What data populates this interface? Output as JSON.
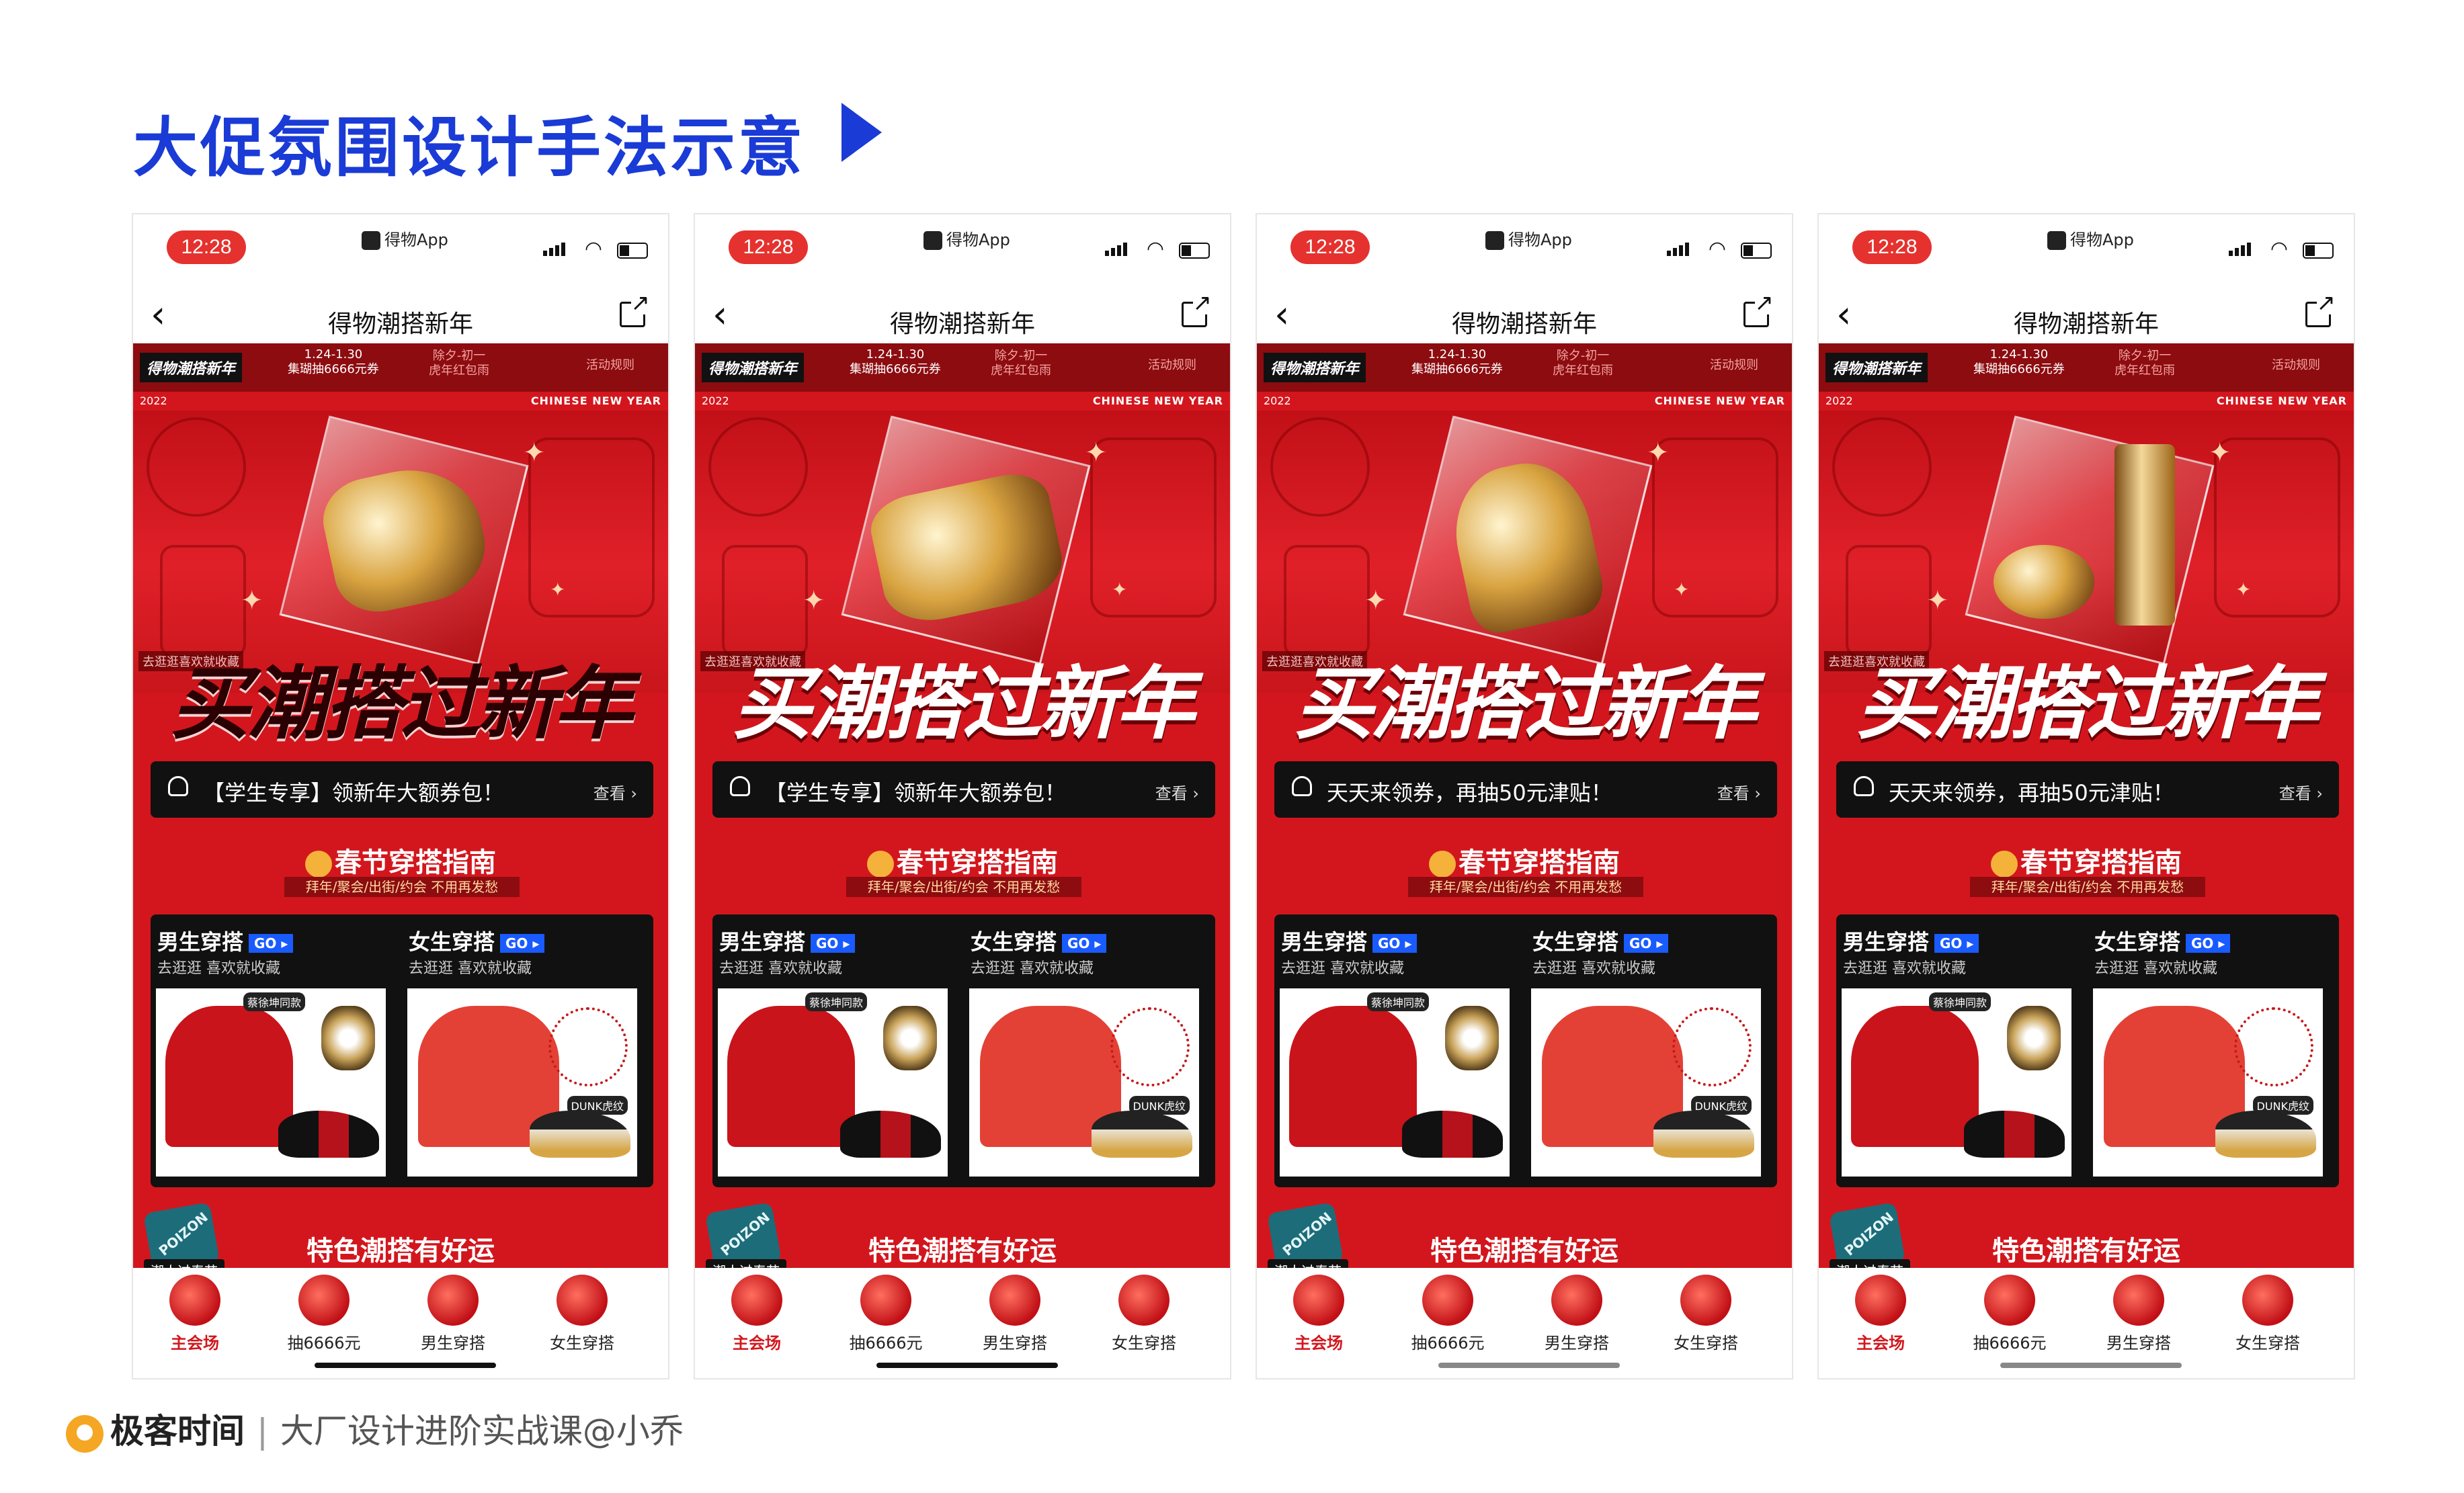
{
  "slide": {
    "title": "大促氛围设计手法示意",
    "arrow_icon": "play-triangle-icon",
    "accent": "#1a3bd6"
  },
  "phones": [
    {
      "status_time": "12:28",
      "app_tag": "得物App",
      "nav_title": "得物潮搭新年",
      "top": {
        "brand": "得物潮搭新年",
        "date": "1.24-1.30",
        "date_sub": "集瑚抽6666元券",
        "deal": "除夕-初一",
        "deal_sub": "虎年红包雨",
        "act": "活动规则"
      },
      "year": "2022",
      "cny": "CHINESE NEW YEAR",
      "hero_hint": "去逛逛喜欢就收藏",
      "hero_product": "sneaker",
      "slogan": "买潮搭过新年",
      "notice": "【学生专享】领新年大额券包！",
      "notice_more": "查看 ›",
      "section_title": "春节穿搭指南",
      "section_sub": "拜年/聚会/出街/约会 不用再发愁",
      "men_title": "男生穿搭",
      "women_title": "女生穿搭",
      "go": "GO ▸",
      "men_sub": "去逛逛 喜欢就收藏",
      "women_sub": "去逛逛 喜欢就收藏",
      "men_tag": "蔡徐坤同款",
      "women_tag": "DUNK虎纹",
      "feature_title": "特色潮搭有好运",
      "badge": "POIZON",
      "badge_label": "潮人过春节",
      "tabs": [
        "主会场",
        "抽6666元",
        "男生穿搭",
        "女生穿搭"
      ]
    },
    {
      "status_time": "12:28",
      "app_tag": "得物App",
      "nav_title": "得物潮搭新年",
      "top": {
        "brand": "得物潮搭新年",
        "date": "1.24-1.30",
        "date_sub": "集瑚抽6666元券",
        "deal": "除夕-初一",
        "deal_sub": "虎年红包雨",
        "act": "活动规则"
      },
      "year": "2022",
      "cny": "CHINESE NEW YEAR",
      "hero_hint": "去逛逛喜欢就收藏",
      "hero_product": "bag",
      "slogan": "买潮搭过新年",
      "notice": "【学生专享】领新年大额券包！",
      "notice_more": "查看 ›",
      "section_title": "春节穿搭指南",
      "section_sub": "拜年/聚会/出街/约会 不用再发愁",
      "men_title": "男生穿搭",
      "women_title": "女生穿搭",
      "go": "GO ▸",
      "men_sub": "去逛逛 喜欢就收藏",
      "women_sub": "去逛逛 喜欢就收藏",
      "men_tag": "蔡徐坤同款",
      "women_tag": "DUNK虎纹",
      "feature_title": "特色潮搭有好运",
      "badge": "POIZON",
      "badge_label": "潮人过春节",
      "tabs": [
        "主会场",
        "抽6666元",
        "男生穿搭",
        "女生穿搭"
      ]
    },
    {
      "status_time": "12:28",
      "app_tag": "得物App",
      "nav_title": "得物潮搭新年",
      "top": {
        "brand": "得物潮搭新年",
        "date": "1.24-1.30",
        "date_sub": "集瑚抽6666元券",
        "deal": "除夕-初一",
        "deal_sub": "虎年红包雨",
        "act": "活动规则"
      },
      "year": "2022",
      "cny": "CHINESE NEW YEAR",
      "hero_hint": "去逛逛喜欢就收藏",
      "hero_product": "dress",
      "slogan": "买潮搭过新年",
      "notice": "天天来领券，再抽50元津贴！",
      "notice_more": "查看 ›",
      "section_title": "春节穿搭指南",
      "section_sub": "拜年/聚会/出街/约会 不用再发愁",
      "men_title": "男生穿搭",
      "women_title": "女生穿搭",
      "go": "GO ▸",
      "men_sub": "去逛逛 喜欢就收藏",
      "women_sub": "去逛逛 喜欢就收藏",
      "men_tag": "蔡徐坤同款",
      "women_tag": "DUNK虎纹",
      "feature_title": "特色潮搭有好运",
      "badge": "POIZON",
      "badge_label": "潮人过春节",
      "tabs": [
        "主会场",
        "抽6666元",
        "男生穿搭",
        "女生穿搭"
      ]
    },
    {
      "status_time": "12:28",
      "app_tag": "得物App",
      "nav_title": "得物潮搭新年",
      "top": {
        "brand": "得物潮搭新年",
        "date": "1.24-1.30",
        "date_sub": "集瑚抽6666元券",
        "deal": "除夕-初一",
        "deal_sub": "虎年红包雨",
        "act": "活动规则"
      },
      "year": "2022",
      "cny": "CHINESE NEW YEAR",
      "hero_hint": "去逛逛喜欢就收藏",
      "hero_product": "cosmetics",
      "slogan": "买潮搭过新年",
      "notice": "天天来领券，再抽50元津贴！",
      "notice_more": "查看 ›",
      "section_title": "春节穿搭指南",
      "section_sub": "拜年/聚会/出街/约会 不用再发愁",
      "men_title": "男生穿搭",
      "women_title": "女生穿搭",
      "go": "GO ▸",
      "men_sub": "去逛逛 喜欢就收藏",
      "women_sub": "去逛逛 喜欢就收藏",
      "men_tag": "蔡徐坤同款",
      "women_tag": "DUNK虎纹",
      "feature_title": "特色潮搭有好运",
      "badge": "POIZON",
      "badge_label": "潮人过春节",
      "tabs": [
        "主会场",
        "抽6666元",
        "男生穿搭",
        "女生穿搭"
      ]
    }
  ],
  "footer": {
    "brand": "极客时间",
    "separator": "|",
    "credit": "大厂设计进阶实战课@小乔"
  }
}
